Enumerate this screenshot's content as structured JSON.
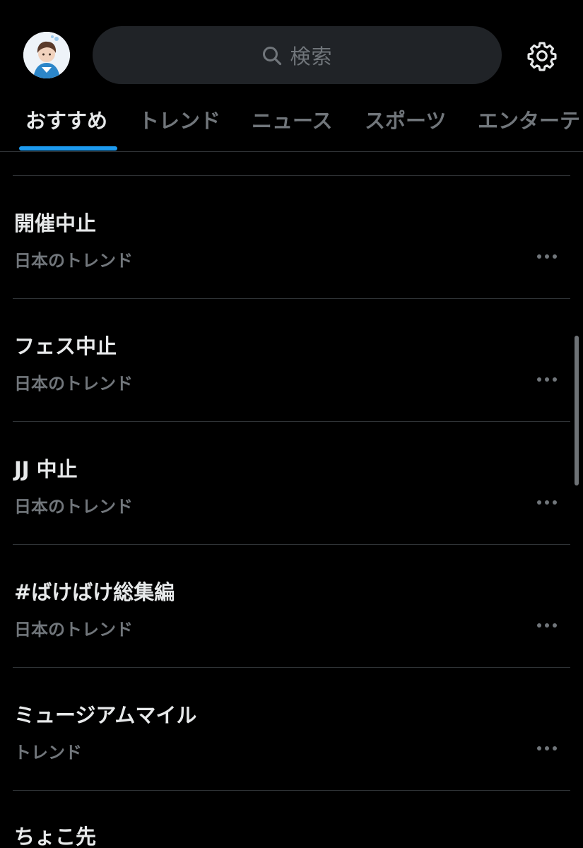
{
  "header": {
    "avatar_alt": "profile avatar",
    "search_placeholder": "検索"
  },
  "tabs": [
    {
      "label": "おすすめ",
      "active": true
    },
    {
      "label": "トレンド",
      "active": false
    },
    {
      "label": "ニュース",
      "active": false
    },
    {
      "label": "スポーツ",
      "active": false
    },
    {
      "label": "エンターテ",
      "active": false
    }
  ],
  "trends": [
    {
      "title": "開催中止",
      "context": "日本のトレンド"
    },
    {
      "title": "フェス中止",
      "context": "日本のトレンド"
    },
    {
      "title": "JJ 中止",
      "context": "日本のトレンド"
    },
    {
      "title": "#ばけばけ総集編",
      "context": "日本のトレンド"
    },
    {
      "title": "ミュージアムマイル",
      "context": "トレンド"
    },
    {
      "title": "ちょこ先",
      "context": ""
    }
  ],
  "colors": {
    "background": "#000000",
    "text_primary": "#e7e9ea",
    "text_secondary": "#71767b",
    "accent": "#1d9bf0",
    "divider": "#2f3336",
    "search_bg": "#202327"
  },
  "icons": {
    "search": "search-icon",
    "settings": "gear-icon",
    "more": "more-horizontal-icon"
  }
}
